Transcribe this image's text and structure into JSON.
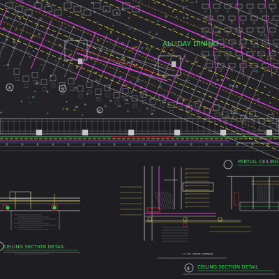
{
  "drawing": {
    "plan_title": "ALL DAY DINING",
    "markers": [
      "8",
      "9",
      "6"
    ],
    "partial_title": "PARTIAL CEILING P",
    "left_detail_title": "CEILING SECTION DETAIL",
    "right_detail_title": "CEILING SECTION DETAIL",
    "section_marker_left": "8",
    "section_marker_right": "8",
    "mid_note": "1 / 1 TILE - SECTION D DIMENSION"
  },
  "colors": {
    "background": "#1e1e22",
    "magenta": "#e040e0",
    "yellow": "#e8d84a",
    "orange": "#e0a030",
    "red": "#e03030",
    "green": "#30d850",
    "cyan": "#40c8d8",
    "white": "#d8d8d8",
    "gray": "#8a8a8a",
    "blue": "#4060e0"
  }
}
